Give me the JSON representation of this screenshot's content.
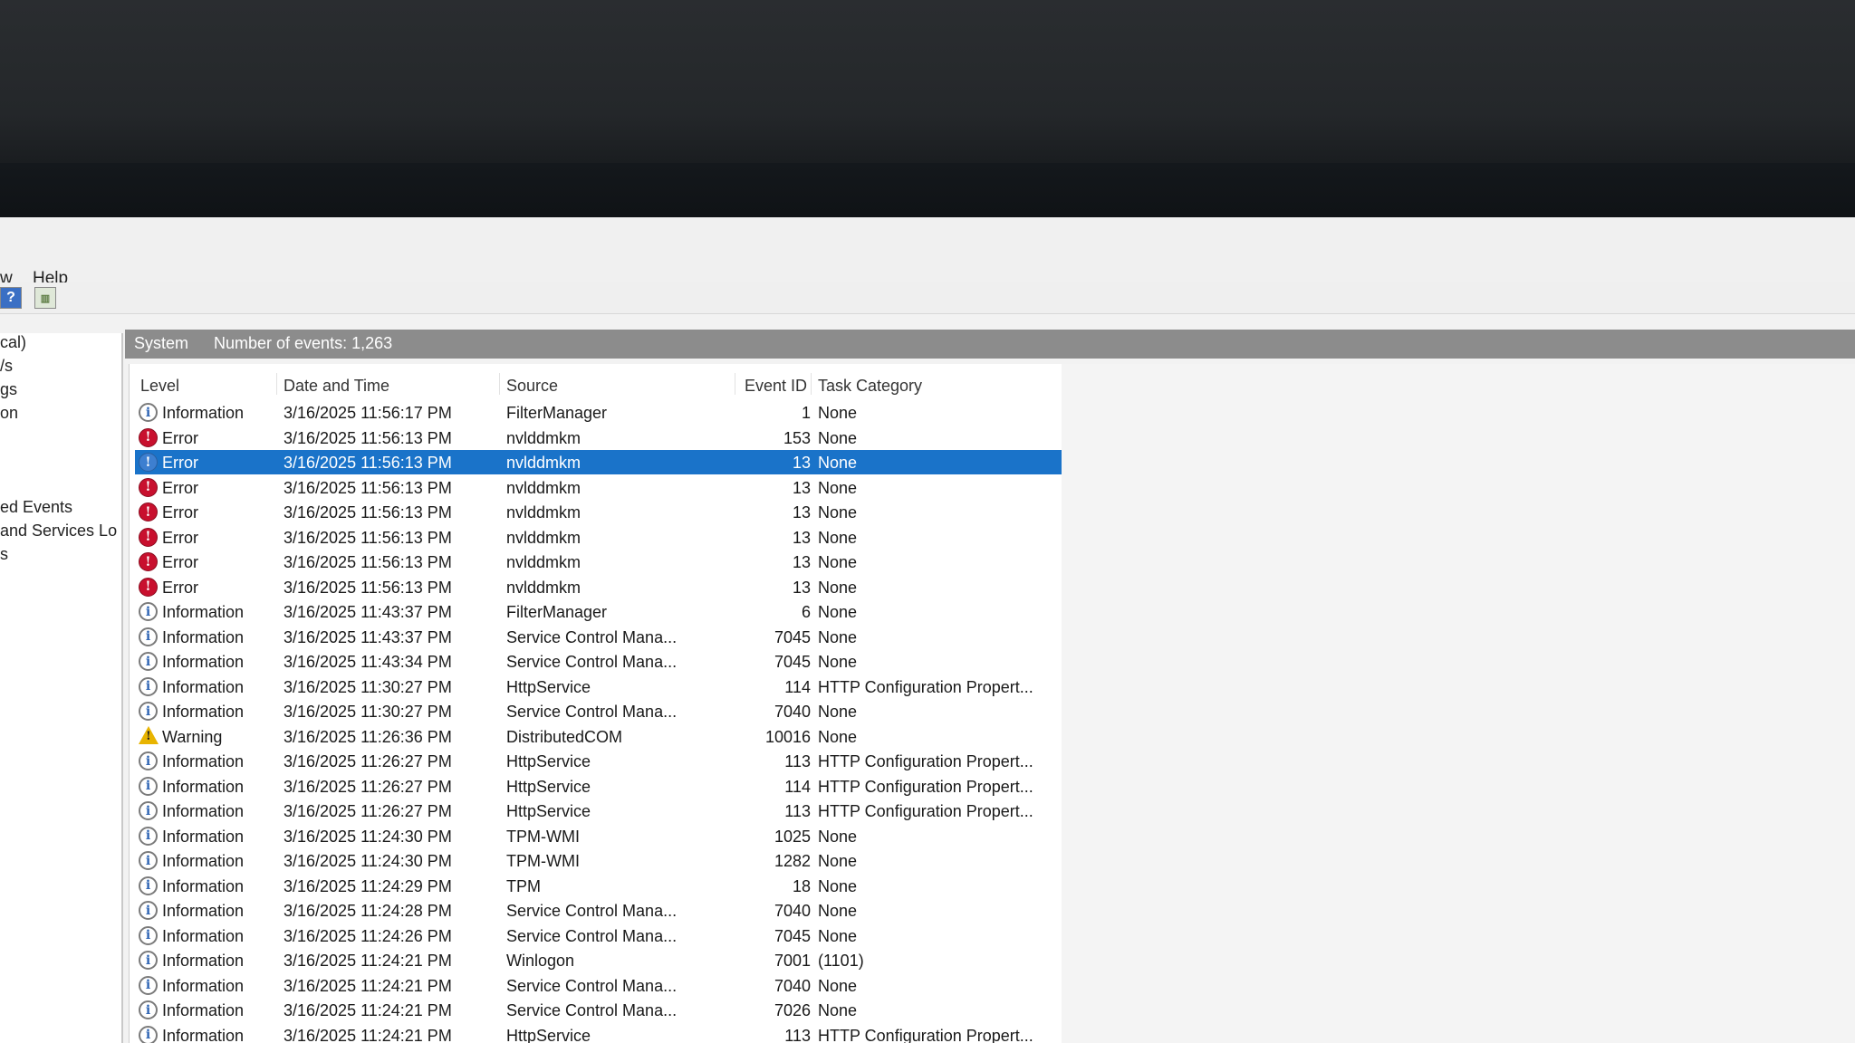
{
  "menu": {
    "view_fragment": "w",
    "help": "Help"
  },
  "toolbar": {
    "help_glyph": "?",
    "pane_glyph": "▥"
  },
  "tree": {
    "items": [
      "cal)",
      "/s",
      "gs",
      "on",
      "ed Events",
      " and Services Lo",
      "s"
    ]
  },
  "pane": {
    "log_name": "System",
    "event_count": "Number of events: 1,263"
  },
  "columns": {
    "level": "Level",
    "date_time": "Date and Time",
    "source": "Source",
    "event_id": "Event ID",
    "task_category": "Task Category"
  },
  "events": [
    {
      "level": "Information",
      "icon": "info",
      "date": "3/16/2025 11:56:17 PM",
      "source": "FilterManager",
      "id": "1",
      "category": "None"
    },
    {
      "level": "Error",
      "icon": "error",
      "date": "3/16/2025 11:56:13 PM",
      "source": "nvlddmkm",
      "id": "153",
      "category": "None"
    },
    {
      "level": "Error",
      "icon": "error",
      "date": "3/16/2025 11:56:13 PM",
      "source": "nvlddmkm",
      "id": "13",
      "category": "None",
      "selected": true
    },
    {
      "level": "Error",
      "icon": "error",
      "date": "3/16/2025 11:56:13 PM",
      "source": "nvlddmkm",
      "id": "13",
      "category": "None"
    },
    {
      "level": "Error",
      "icon": "error",
      "date": "3/16/2025 11:56:13 PM",
      "source": "nvlddmkm",
      "id": "13",
      "category": "None"
    },
    {
      "level": "Error",
      "icon": "error",
      "date": "3/16/2025 11:56:13 PM",
      "source": "nvlddmkm",
      "id": "13",
      "category": "None"
    },
    {
      "level": "Error",
      "icon": "error",
      "date": "3/16/2025 11:56:13 PM",
      "source": "nvlddmkm",
      "id": "13",
      "category": "None"
    },
    {
      "level": "Error",
      "icon": "error",
      "date": "3/16/2025 11:56:13 PM",
      "source": "nvlddmkm",
      "id": "13",
      "category": "None"
    },
    {
      "level": "Information",
      "icon": "info",
      "date": "3/16/2025 11:43:37 PM",
      "source": "FilterManager",
      "id": "6",
      "category": "None"
    },
    {
      "level": "Information",
      "icon": "info",
      "date": "3/16/2025 11:43:37 PM",
      "source": "Service Control Mana...",
      "id": "7045",
      "category": "None"
    },
    {
      "level": "Information",
      "icon": "info",
      "date": "3/16/2025 11:43:34 PM",
      "source": "Service Control Mana...",
      "id": "7045",
      "category": "None"
    },
    {
      "level": "Information",
      "icon": "info",
      "date": "3/16/2025 11:30:27 PM",
      "source": "HttpService",
      "id": "114",
      "category": "HTTP Configuration Propert..."
    },
    {
      "level": "Information",
      "icon": "info",
      "date": "3/16/2025 11:30:27 PM",
      "source": "Service Control Mana...",
      "id": "7040",
      "category": "None"
    },
    {
      "level": "Warning",
      "icon": "warning",
      "date": "3/16/2025 11:26:36 PM",
      "source": "DistributedCOM",
      "id": "10016",
      "category": "None"
    },
    {
      "level": "Information",
      "icon": "info",
      "date": "3/16/2025 11:26:27 PM",
      "source": "HttpService",
      "id": "113",
      "category": "HTTP Configuration Propert..."
    },
    {
      "level": "Information",
      "icon": "info",
      "date": "3/16/2025 11:26:27 PM",
      "source": "HttpService",
      "id": "114",
      "category": "HTTP Configuration Propert..."
    },
    {
      "level": "Information",
      "icon": "info",
      "date": "3/16/2025 11:26:27 PM",
      "source": "HttpService",
      "id": "113",
      "category": "HTTP Configuration Propert..."
    },
    {
      "level": "Information",
      "icon": "info",
      "date": "3/16/2025 11:24:30 PM",
      "source": "TPM-WMI",
      "id": "1025",
      "category": "None"
    },
    {
      "level": "Information",
      "icon": "info",
      "date": "3/16/2025 11:24:30 PM",
      "source": "TPM-WMI",
      "id": "1282",
      "category": "None"
    },
    {
      "level": "Information",
      "icon": "info",
      "date": "3/16/2025 11:24:29 PM",
      "source": "TPM",
      "id": "18",
      "category": "None"
    },
    {
      "level": "Information",
      "icon": "info",
      "date": "3/16/2025 11:24:28 PM",
      "source": "Service Control Mana...",
      "id": "7040",
      "category": "None"
    },
    {
      "level": "Information",
      "icon": "info",
      "date": "3/16/2025 11:24:26 PM",
      "source": "Service Control Mana...",
      "id": "7045",
      "category": "None"
    },
    {
      "level": "Information",
      "icon": "info",
      "date": "3/16/2025 11:24:21 PM",
      "source": "Winlogon",
      "id": "7001",
      "category": "(1101)"
    },
    {
      "level": "Information",
      "icon": "info",
      "date": "3/16/2025 11:24:21 PM",
      "source": "Service Control Mana...",
      "id": "7040",
      "category": "None"
    },
    {
      "level": "Information",
      "icon": "info",
      "date": "3/16/2025 11:24:21 PM",
      "source": "Service Control Mana...",
      "id": "7026",
      "category": "None"
    },
    {
      "level": "Information",
      "icon": "info",
      "date": "3/16/2025 11:24:21 PM",
      "source": "HttpService",
      "id": "113",
      "category": "HTTP Configuration Propert..."
    }
  ]
}
